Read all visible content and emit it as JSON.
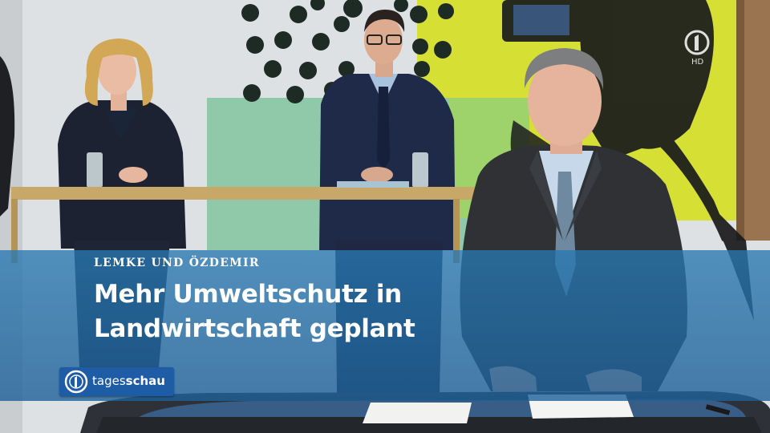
{
  "broadcast": {
    "kicker": "LEMKE UND ÖZDEMIR",
    "headline_line1": "Mehr Umweltschutz in",
    "headline_line2": "Landwirtschaft geplant",
    "show_logo_prefix": "tages",
    "show_logo_suffix": "schau",
    "channel_bug_label": "HD",
    "channel_bug_icon": "ard-1-logo-icon"
  },
  "colors": {
    "lower_third": "#2a78b4",
    "logo_bg": "#1e5ca6",
    "backdrop_yellow": "#d6e034",
    "backdrop_green": "#8fc9a9"
  }
}
